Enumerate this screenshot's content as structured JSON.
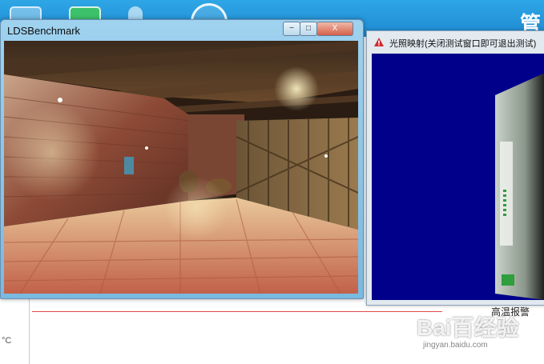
{
  "host": {
    "temperature_unit": "°C",
    "alarm_label": "高温报警"
  },
  "benchmark_window": {
    "title": "LDSBenchmark",
    "min_glyph": "−",
    "max_glyph": "□",
    "close_glyph": "X"
  },
  "preview_window": {
    "title": "光照映射(关闭测试窗口即可退出测试)"
  },
  "watermark": {
    "text": "Bai百经验",
    "url": "jingyan.baidu.com"
  },
  "colors": {
    "host_bar": "#1e89d0",
    "preview_background": "#00008b",
    "alarm_line": "#e04a4a"
  },
  "icons": [
    "app-icon",
    "fan-icon",
    "thermometer-icon",
    "gauge-icon",
    "warning-icon"
  ]
}
